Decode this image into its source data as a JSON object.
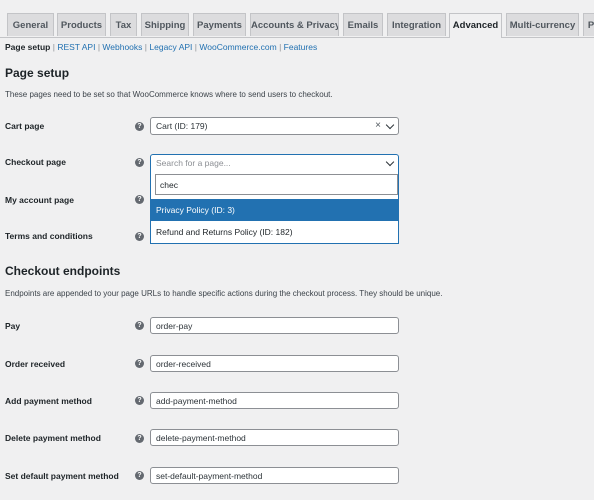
{
  "tabs": [
    "General",
    "Products",
    "Tax",
    "Shipping",
    "Payments",
    "Accounts & Privacy",
    "Emails",
    "Integration",
    "Advanced",
    "Multi-currency",
    "P"
  ],
  "active_tab": "Advanced",
  "subnav": {
    "current": "Page setup",
    "links": [
      "REST API",
      "Webhooks",
      "Legacy API",
      "WooCommerce.com",
      "Features"
    ],
    "separator": "|"
  },
  "page_setup": {
    "title": "Page setup",
    "description": "These pages need to be set so that WooCommerce knows where to send users to checkout.",
    "cart": {
      "label": "Cart page",
      "value": "Cart (ID: 179)"
    },
    "checkout": {
      "label": "Checkout page",
      "placeholder": "Search for a page...",
      "search_value": "chec",
      "options": [
        "Privacy Policy (ID: 3)",
        "Refund and Returns Policy (ID: 182)"
      ]
    },
    "my_account": {
      "label": "My account page"
    },
    "terms": {
      "label": "Terms and conditions"
    }
  },
  "endpoints": {
    "title": "Checkout endpoints",
    "description": "Endpoints are appended to your page URLs to handle specific actions during the checkout process. They should be unique.",
    "fields": [
      {
        "label": "Pay",
        "value": "order-pay"
      },
      {
        "label": "Order received",
        "value": "order-received"
      },
      {
        "label": "Add payment method",
        "value": "add-payment-method"
      },
      {
        "label": "Delete payment method",
        "value": "delete-payment-method"
      },
      {
        "label": "Set default payment method",
        "value": "set-default-payment-method"
      }
    ]
  },
  "help_glyph": "?",
  "clear_glyph": "×",
  "colors": {
    "accent": "#2271b1",
    "link": "#2271b1",
    "background": "#f0f0f1",
    "tab_inactive": "#dcdcde"
  }
}
